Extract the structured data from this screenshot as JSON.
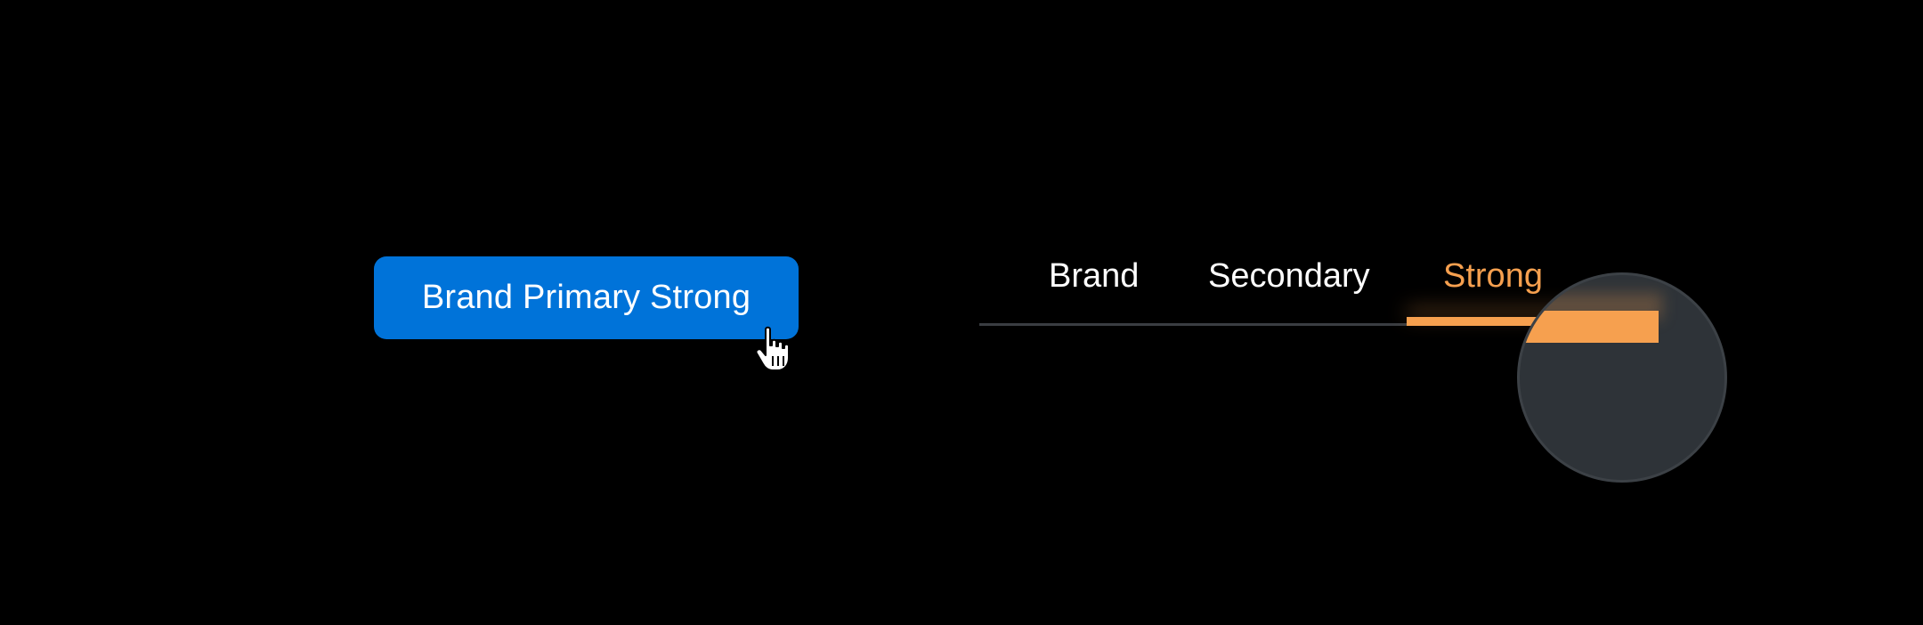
{
  "colors": {
    "background": "#000000",
    "primary": "#0073d9",
    "accent": "#f6a04f",
    "magnifier": "#2e3338"
  },
  "primary_button": {
    "label": "Brand Primary Strong"
  },
  "tabs": {
    "items": [
      {
        "label": "Brand",
        "active": false
      },
      {
        "label": "Secondary",
        "active": false
      },
      {
        "label": "Strong",
        "active": true
      }
    ]
  },
  "icons": {
    "cursor": "hand-pointer-icon"
  }
}
